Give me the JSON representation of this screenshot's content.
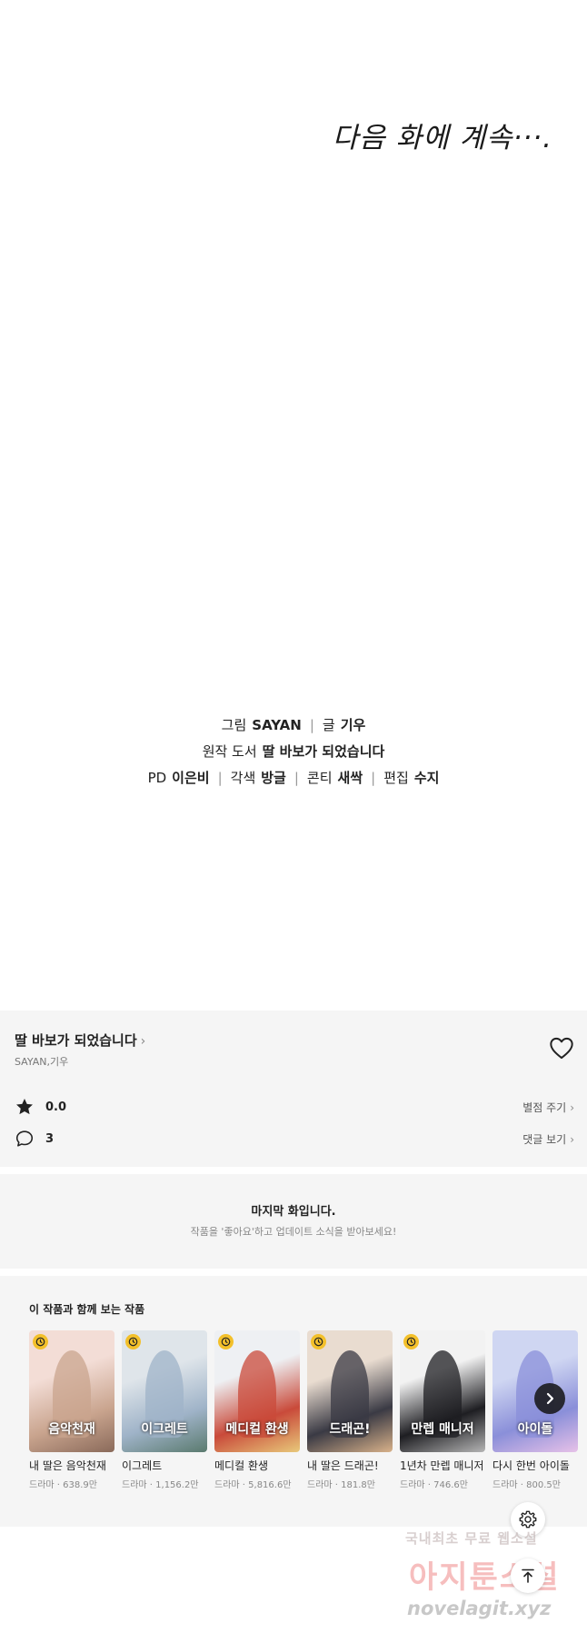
{
  "episode_end": {
    "continue_text": "다음 화에 계속···."
  },
  "credits": {
    "art_label": "그림",
    "art_value": "SAYAN",
    "story_label": "글",
    "story_value": "기우",
    "original_label": "원작 도서",
    "original_value": "딸 바보가 되었습니다",
    "pd_label": "PD",
    "pd_value": "이은비",
    "adapt_label": "각색",
    "adapt_value": "방글",
    "storyboard_label": "콘티",
    "storyboard_value": "새싹",
    "editor_label": "편집",
    "editor_value": "수지"
  },
  "series": {
    "title": "딸 바보가 되었습니다",
    "authors": "SAYAN,기우",
    "rating": "0.0",
    "rate_action": "별점 주기",
    "comment_count": "3",
    "comment_action": "댓글 보기"
  },
  "last_episode": {
    "title": "마지막 화입니다.",
    "subtitle": "작품을 '좋아요'하고 업데이트 소식을 받아보세요!"
  },
  "recommendations": {
    "heading": "이 작품과 함께 보는 작품",
    "items": [
      {
        "title": "내 딸은 음악천재",
        "genre": "드라마",
        "views": "638.9만",
        "colors": [
          "#f3ddd6",
          "#c9a48e",
          "#8a6a5a"
        ],
        "logo": "음악천재"
      },
      {
        "title": "이그레트",
        "genre": "드라마",
        "views": "1,156.2만",
        "colors": [
          "#dfe5ea",
          "#9fb3c8",
          "#5a7a6e"
        ],
        "logo": "이그레트"
      },
      {
        "title": "메디컬 환생",
        "genre": "드라마",
        "views": "5,816.6만",
        "colors": [
          "#eef0f3",
          "#c94a3a",
          "#e8c97a"
        ],
        "logo": "메디컬 환생"
      },
      {
        "title": "내 딸은 드래곤!",
        "genre": "드라마",
        "views": "181.8만",
        "colors": [
          "#e9dcd0",
          "#3a3a44",
          "#d9b28a"
        ],
        "logo": "드래곤!"
      },
      {
        "title": "1년차 만렙 매니저",
        "genre": "드라마",
        "views": "746.6만",
        "colors": [
          "#f2f2f2",
          "#1e1e22",
          "#b5b5b5"
        ],
        "logo": "만렙 매니저"
      },
      {
        "title": "다시 한번 아이돌",
        "genre": "드라마",
        "views": "800.5만",
        "colors": [
          "#cfd6f2",
          "#8a8fd9",
          "#e7c1e8"
        ],
        "logo": "아이돌"
      }
    ]
  },
  "watermark": {
    "line1": "국내최초 무료 웹소설",
    "line2": "아지툰소설",
    "line3": "novelagit.xyz"
  },
  "icons": {
    "heart": "heart-outline-icon",
    "star": "star-icon",
    "comment": "comment-bubble-icon",
    "clock": "clock-badge-icon",
    "next": "chevron-right-icon",
    "settings": "gear-icon",
    "top": "arrow-up-icon"
  }
}
